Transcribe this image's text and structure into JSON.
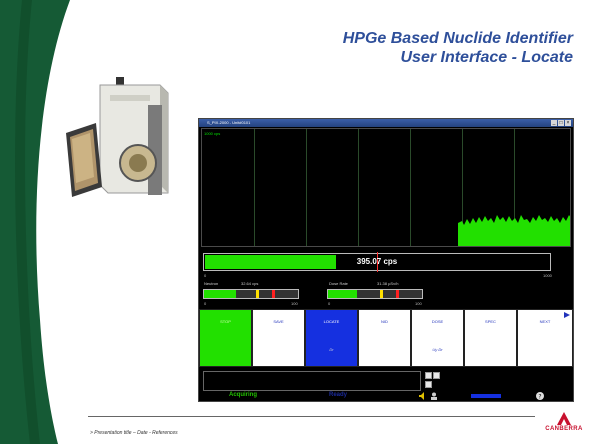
{
  "slide": {
    "title_line1": "HPGe Based Nuclide Identifier",
    "title_line2": "User Interface - Locate",
    "footer": "> Presentation title – Date - References",
    "logo_text": "CANBERRA",
    "brand_color": "#c8102e",
    "title_color": "#2e4f9a"
  },
  "app": {
    "window_title": "S_PIX-2000 - Unit#0101",
    "spectrum": {
      "top_label": "1000 cps",
      "bottom_right_label": "300 sec"
    },
    "rate_bar": {
      "value_label": "395.07 cps",
      "fill_fraction": 0.38,
      "fill_color": "#22e000",
      "scale_min": "0",
      "scale_max": "1000"
    },
    "neutron": {
      "label": "Neutron",
      "value": "32.64 cps",
      "scale_min": "0",
      "scale_max": "100"
    },
    "dose": {
      "label": "Dose Rate",
      "value": "31.38 µSv/h",
      "scale_min": "0",
      "scale_max": "100"
    },
    "buttons": [
      {
        "label": "STOP",
        "sub": ""
      },
      {
        "label": "SAVE",
        "sub": ""
      },
      {
        "label": "LOCATE",
        "sub": "Dr"
      },
      {
        "label": "NID",
        "sub": ""
      },
      {
        "label": "DOSE",
        "sub": "Uy Dr"
      },
      {
        "label": "SPEC",
        "sub": ""
      },
      {
        "label": "NEXT",
        "sub": ""
      }
    ],
    "status": {
      "left": "Acquiring",
      "middle": "Ready"
    }
  }
}
